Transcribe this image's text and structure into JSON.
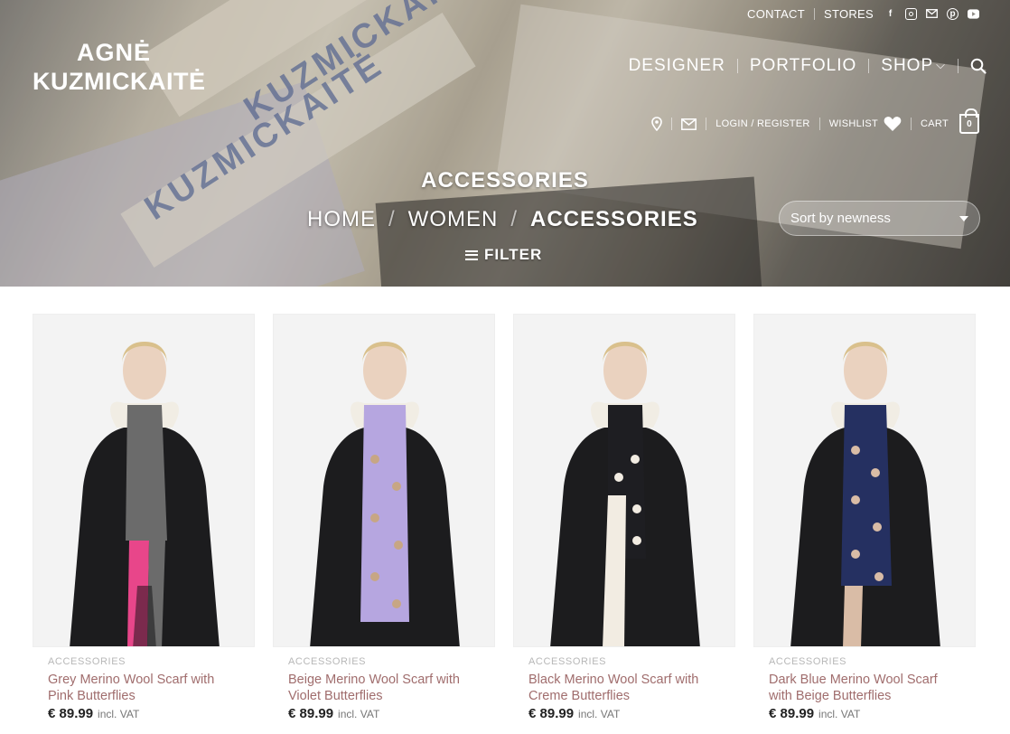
{
  "topbar": {
    "contact": "CONTACT",
    "stores": "STORES",
    "social_icons": [
      "facebook-icon",
      "instagram-icon",
      "email-icon",
      "pinterest-icon",
      "youtube-icon"
    ]
  },
  "logo": {
    "line1": "AGNĖ",
    "line2": "KUZMICKAITĖ"
  },
  "main_nav": {
    "items": [
      {
        "label": "DESIGNER"
      },
      {
        "label": "PORTFOLIO"
      },
      {
        "label": "SHOP"
      }
    ]
  },
  "sub_nav": {
    "login": "LOGIN / REGISTER",
    "wishlist": "WISHLIST",
    "cart": "CART",
    "cart_count": "0"
  },
  "page": {
    "title": "ACCESSORIES",
    "breadcrumb": [
      "HOME",
      "WOMEN",
      "ACCESSORIES"
    ],
    "filter_label": "FILTER",
    "sort_value": "Sort by newness"
  },
  "colors": {
    "price_text": "#222222",
    "product_name": "#a06d6d",
    "category_text": "#b7b7b7"
  },
  "products": [
    {
      "category": "ACCESSORIES",
      "name": "Grey Merino Wool Scarf with Pink Butterflies",
      "price": "€ 89.99",
      "vat": "incl. VAT",
      "scarf_color": "#6b6b6b",
      "accent_color": "#e8468a"
    },
    {
      "category": "ACCESSORIES",
      "name": "Beige Merino Wool Scarf with Violet Butterflies",
      "price": "€ 89.99",
      "vat": "incl. VAT",
      "scarf_color": "#b6a6e0",
      "accent_color": "#c7a684"
    },
    {
      "category": "ACCESSORIES",
      "name": "Black Merino Wool Scarf with Creme Butterflies",
      "price": "€ 89.99",
      "vat": "incl. VAT",
      "scarf_color": "#1e1e22",
      "accent_color": "#f2ece2"
    },
    {
      "category": "ACCESSORIES",
      "name": "Dark Blue Merino Wool Scarf with Beige Butterflies",
      "price": "€ 89.99",
      "vat": "incl. VAT",
      "scarf_color": "#253061",
      "accent_color": "#d9bca6"
    }
  ]
}
